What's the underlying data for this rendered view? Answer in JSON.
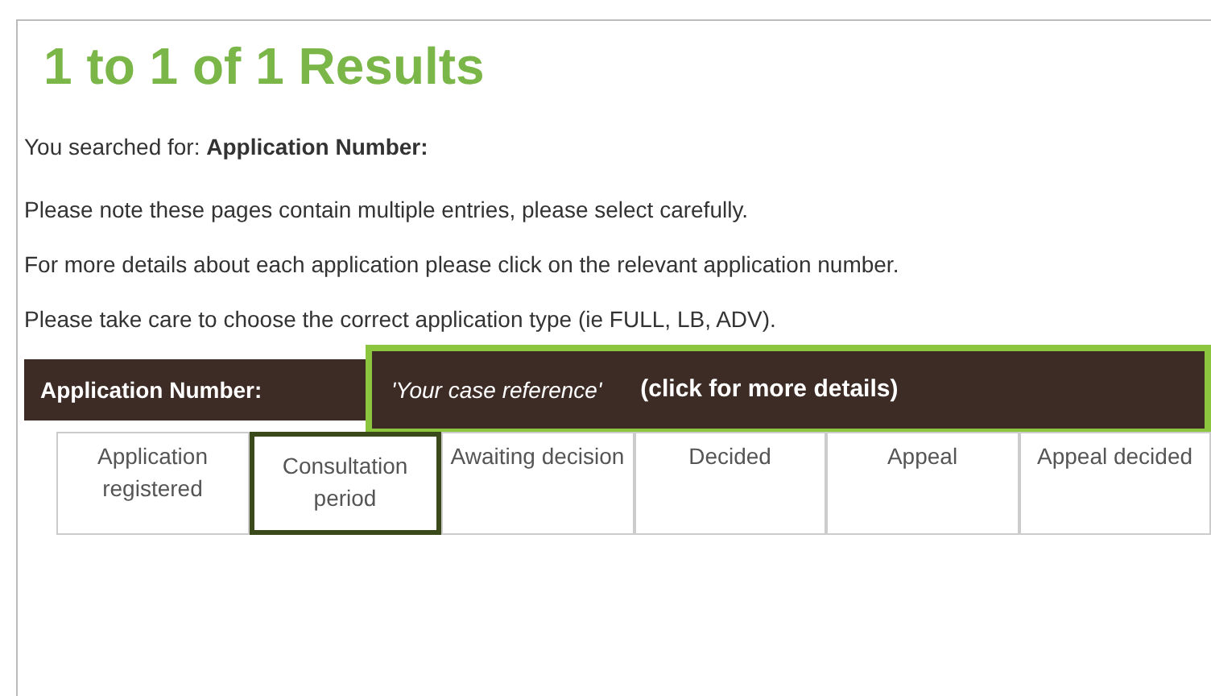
{
  "heading": "1 to 1 of 1 Results",
  "search_summary": "You searched for: **Application Number:**",
  "notes": [
    "Please note these pages contain multiple entries, please select carefully.",
    "For more details about each application please click on the relevant application number.",
    "Please take care to choose the correct application type (ie FULL, LB, ADV)."
  ],
  "result": {
    "label": "Application Number:",
    "reference": "'Your case reference'",
    "link": "(click for more details)",
    "highlighted": true
  },
  "stages": [
    {
      "label": "Application registered",
      "selected": false
    },
    {
      "label": "Consultation period",
      "selected": true
    },
    {
      "label": "Awaiting decision",
      "selected": false
    },
    {
      "label": "Decided",
      "selected": false
    },
    {
      "label": "Appeal",
      "selected": false
    },
    {
      "label": "Appeal decided",
      "selected": false
    }
  ]
}
